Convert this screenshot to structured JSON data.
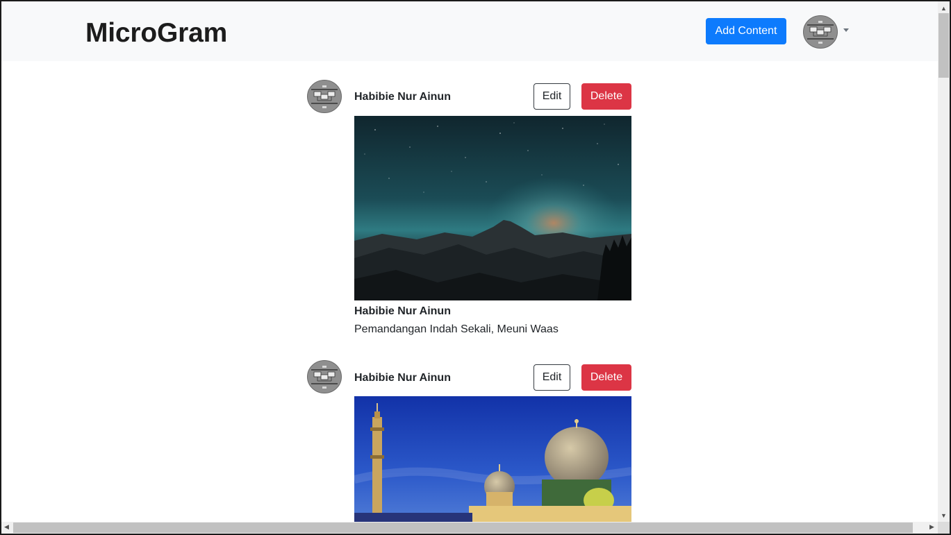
{
  "navbar": {
    "brand": "MicroGram",
    "add_content_label": "Add Content",
    "user_avatar_icon": "user-avatar-icon",
    "dropdown_icon": "caret-down-icon"
  },
  "posts": [
    {
      "author": "Habibie Nur Ainun",
      "edit_label": "Edit",
      "delete_label": "Delete",
      "image": "night-sky-mountains-image",
      "caption_author": "Habibie Nur Ainun",
      "caption": "Pemandangan Indah Sekali, Meuni Waas"
    },
    {
      "author": "Habibie Nur Ainun",
      "edit_label": "Edit",
      "delete_label": "Delete",
      "image": "mosque-domes-image"
    }
  ],
  "colors": {
    "primary": "#0d7bfd",
    "danger": "#dc3545",
    "navbar_bg": "#f8f9fa"
  }
}
